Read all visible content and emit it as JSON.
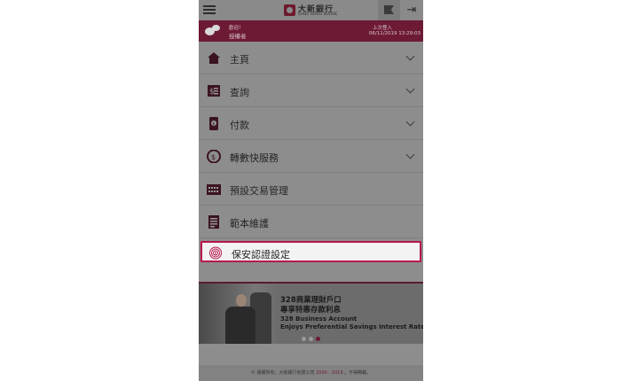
{
  "header": {
    "logo_cn": "大新銀行",
    "logo_en": "DAH SING BANK",
    "menu_icon": "hamburger-icon",
    "notice_icon": "flag-icon",
    "logout_icon": "logout-icon"
  },
  "welcome": {
    "greeting": "歡迎！",
    "name": "授權者",
    "last_login_label": "上次登入",
    "last_login_time": "06/11/2019 13:29:03"
  },
  "menu": {
    "items": [
      {
        "label": "主頁",
        "icon": "home-icon",
        "expandable": true
      },
      {
        "label": "查詢",
        "icon": "statement-icon",
        "expandable": true
      },
      {
        "label": "付款",
        "icon": "payment-icon",
        "expandable": true
      },
      {
        "label": "轉數快服務",
        "icon": "fps-icon",
        "expandable": true
      },
      {
        "label": "預設交易管理",
        "icon": "calendar-icon",
        "expandable": false
      },
      {
        "label": "範本維護",
        "icon": "template-icon",
        "expandable": false
      },
      {
        "label": "保安認證設定",
        "icon": "fingerprint-icon",
        "expandable": false,
        "selected": true
      }
    ]
  },
  "banner": {
    "line1": "328商業理財戶口",
    "line2": "專享特惠存款利息",
    "line3": "328 Business Account",
    "line4": "Enjoys Preferential Savings Interest Rate",
    "active_dot": 3,
    "dot_count": 3
  },
  "footer": {
    "prefix": "© 版權所有，大新銀行有限公司 ",
    "years": "2000 - 2019",
    "suffix": " 。不得轉載。"
  },
  "colors": {
    "brand": "#6d1a35",
    "highlight_border": "#b8174c"
  }
}
